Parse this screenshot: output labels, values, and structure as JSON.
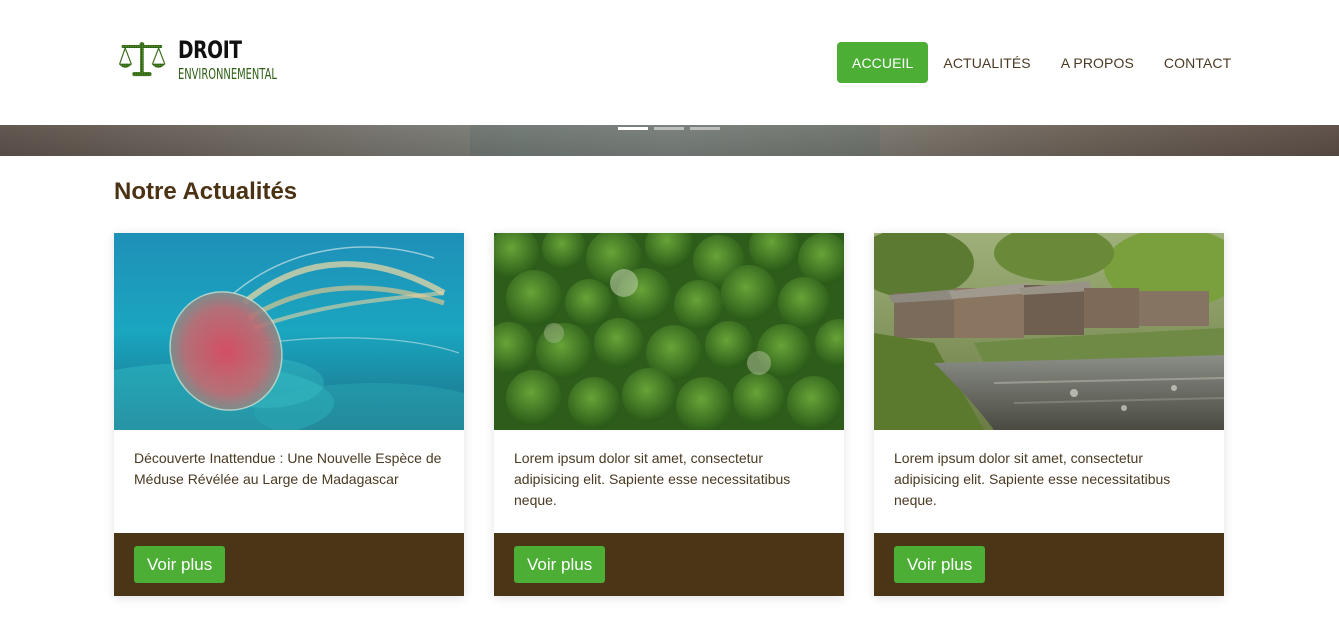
{
  "brand": {
    "line1": "DROIT",
    "line2": "ENVIRONNEMENTAL",
    "icon": "balance-scale-leaf-icon",
    "color": "#2c5e14"
  },
  "nav": {
    "items": [
      {
        "label": "ACCUEIL",
        "active": true
      },
      {
        "label": "ACTUALITÉS",
        "active": false
      },
      {
        "label": "A PROPOS",
        "active": false
      },
      {
        "label": "CONTACT",
        "active": false
      }
    ]
  },
  "hero": {
    "slides": 3,
    "active_slide": 1
  },
  "section": {
    "title": "Notre Actualités"
  },
  "cards": [
    {
      "image": "jellyfish-underwater-photo",
      "text": "Découverte Inattendue : Une Nouvelle Espèce de Méduse Révélée au Large de Madagascar",
      "button": "Voir plus"
    },
    {
      "image": "rainforest-aerial-photo",
      "text": "Lorem ipsum dolor sit amet, consectetur adipisicing elit. Sapiente esse necessitatibus neque.",
      "button": "Voir plus"
    },
    {
      "image": "polluted-river-shacks-photo",
      "text": "Lorem ipsum dolor sit amet, consectetur adipisicing elit. Sapiente esse necessitatibus neque.",
      "button": "Voir plus"
    }
  ],
  "colors": {
    "accent_green": "#4cae34",
    "card_footer_brown": "#4a3617",
    "title_brown": "#4a3212",
    "text_brown": "#4a3a22"
  }
}
